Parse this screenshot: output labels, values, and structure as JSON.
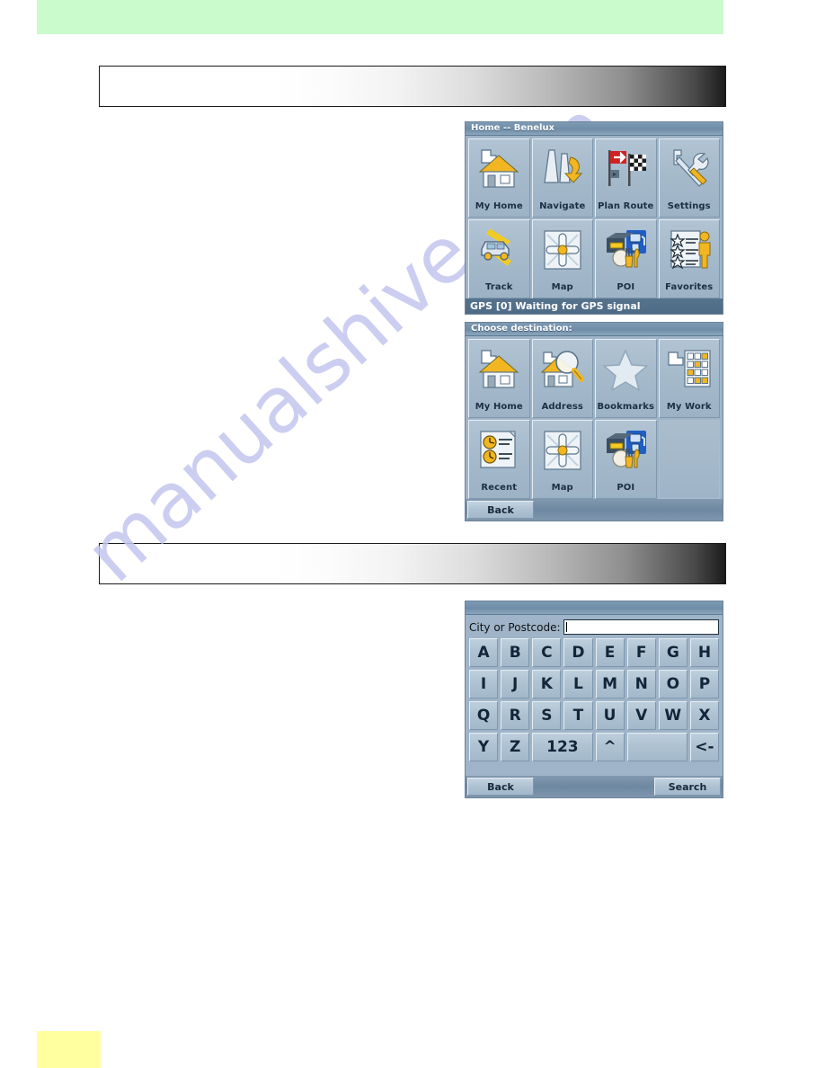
{
  "page": {
    "watermark_text": "manualshive.com",
    "watermark_color": "#c3c6ee",
    "green_band_color": "#c9fbcd",
    "yellow_chip_color": "#ffffa0"
  },
  "screens": {
    "home": {
      "title": "Home -- Benelux",
      "status": "GPS [0] Waiting for GPS signal",
      "tiles": [
        {
          "label": "My Home",
          "icon": "home-icon"
        },
        {
          "label": "Navigate",
          "icon": "navigate-arrow-icon"
        },
        {
          "label": "Plan Route",
          "icon": "plan-route-flags-icon"
        },
        {
          "label": "Settings",
          "icon": "tools-wrench-screwdriver-icon"
        },
        {
          "label": "Track",
          "icon": "car-track-icon"
        },
        {
          "label": "Map",
          "icon": "map-crosshair-icon"
        },
        {
          "label": "POI",
          "icon": "poi-fuel-fork-icon"
        },
        {
          "label": "Favorites",
          "icon": "favorites-stars-person-icon"
        }
      ]
    },
    "destination": {
      "title": "Choose destination:",
      "back_label": "Back",
      "tiles": [
        {
          "label": "My Home",
          "icon": "home-icon"
        },
        {
          "label": "Address",
          "icon": "address-magnifier-icon"
        },
        {
          "label": "Bookmarks",
          "icon": "star-icon"
        },
        {
          "label": "My Work",
          "icon": "my-work-building-icon"
        },
        {
          "label": "Recent",
          "icon": "recent-clock-list-icon"
        },
        {
          "label": "Map",
          "icon": "map-crosshair-icon"
        },
        {
          "label": "POI",
          "icon": "poi-fuel-fork-icon"
        },
        {
          "label": "",
          "icon": ""
        }
      ]
    },
    "keyboard": {
      "field_label": "City or Postcode:",
      "field_value": "",
      "field_placeholder": "",
      "rows": [
        [
          "A",
          "B",
          "C",
          "D",
          "E",
          "F",
          "G",
          "H"
        ],
        [
          "I",
          "J",
          "K",
          "L",
          "M",
          "N",
          "O",
          "P"
        ],
        [
          "Q",
          "R",
          "S",
          "T",
          "U",
          "V",
          "W",
          "X"
        ],
        [
          "Y",
          "Z",
          "123",
          "^",
          " ",
          "<-"
        ]
      ],
      "back_label": "Back",
      "search_label": "Search"
    }
  }
}
